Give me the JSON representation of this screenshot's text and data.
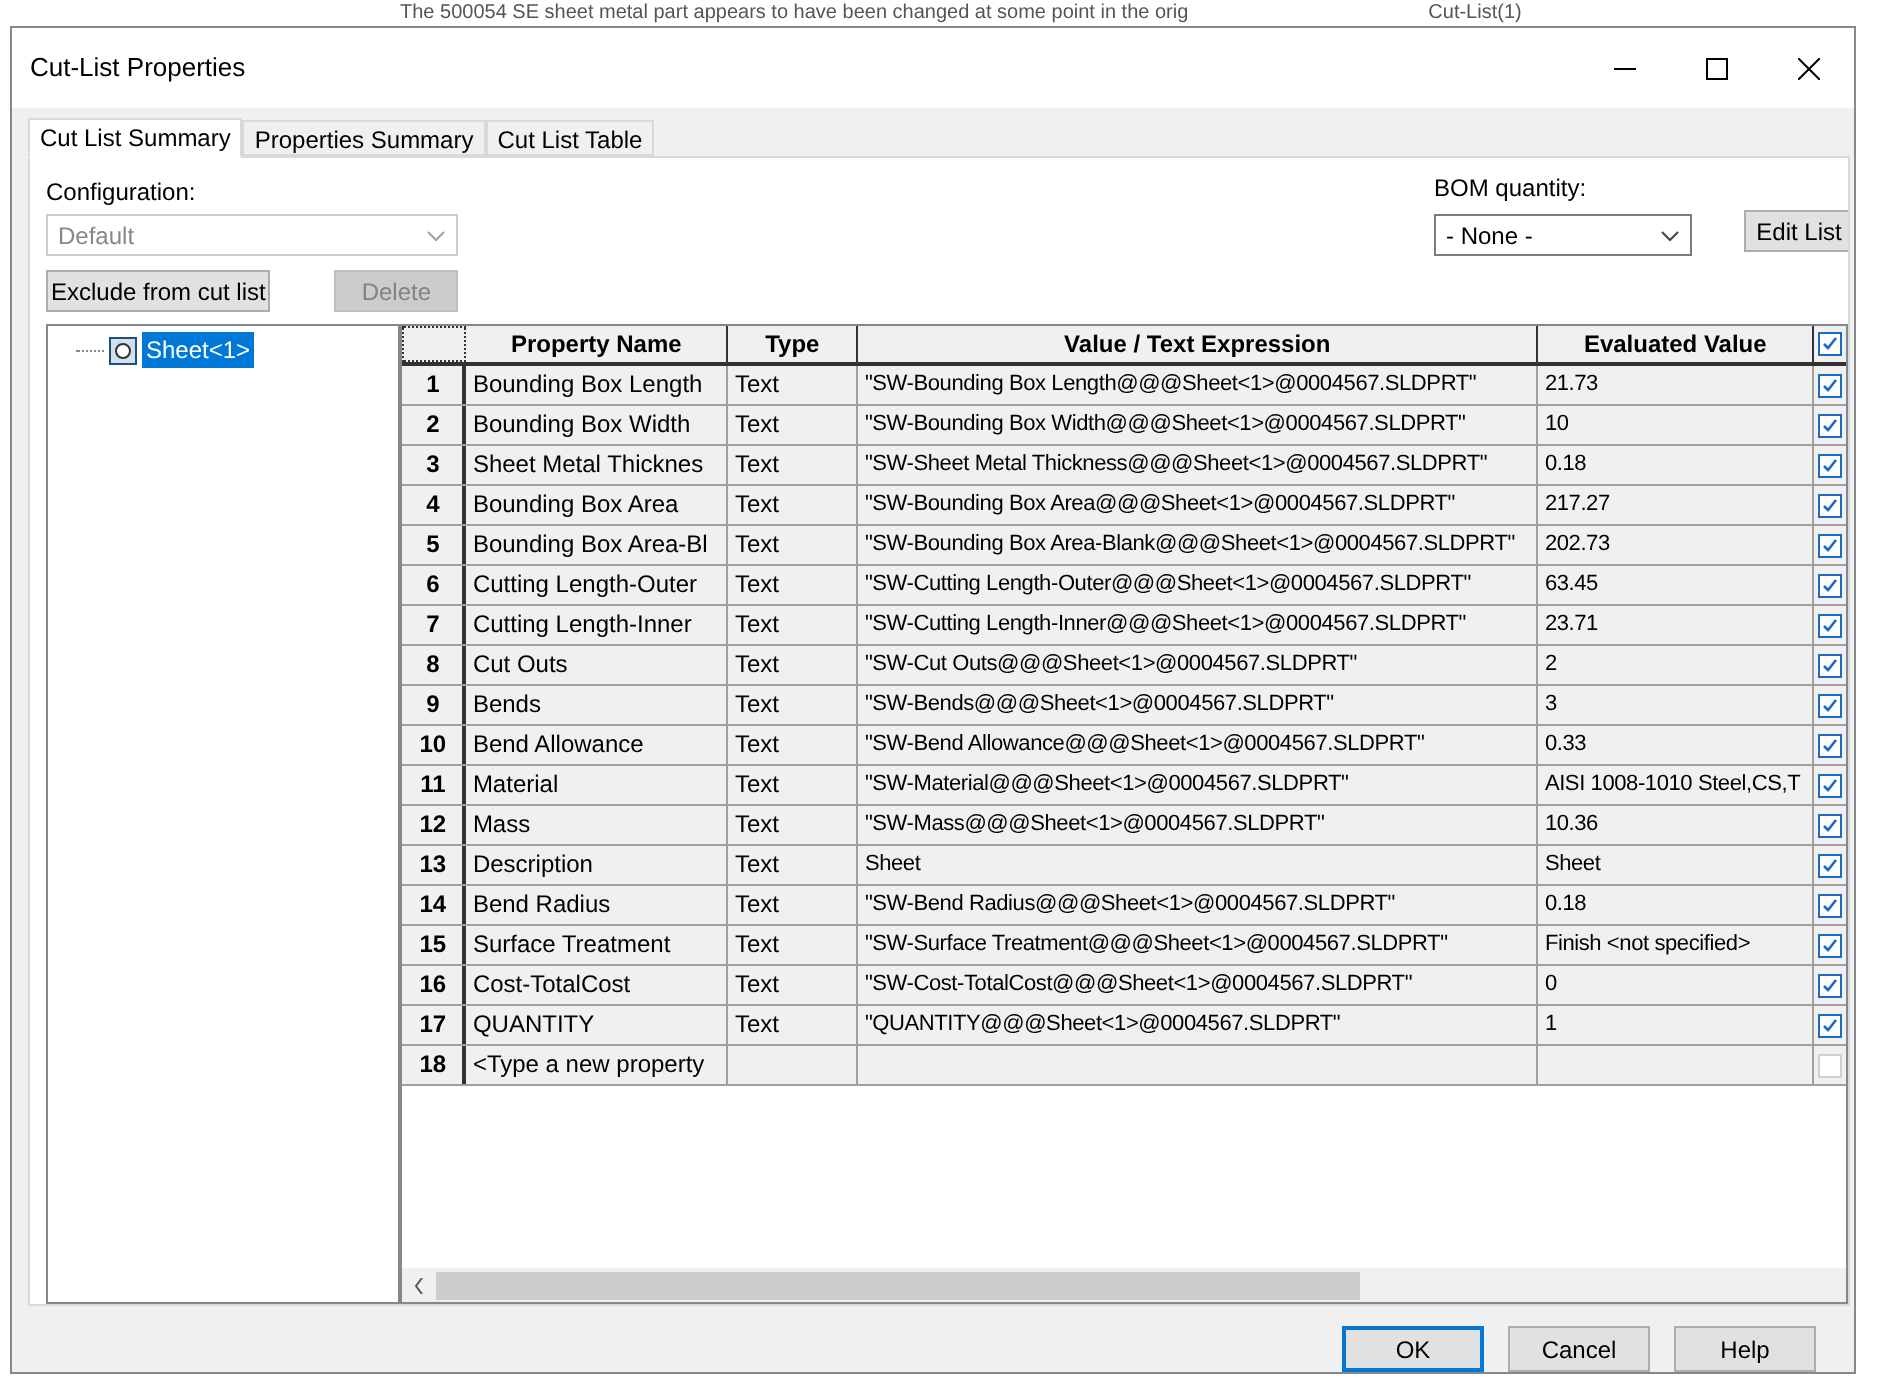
{
  "background": {
    "text": "The 500054 SE sheet metal part appears to have been changed at some point in the orig",
    "item": "Cut-List(1)"
  },
  "window": {
    "title": "Cut-List Properties"
  },
  "tabs": [
    {
      "label": "Cut List Summary",
      "selected": true
    },
    {
      "label": "Properties Summary",
      "selected": false
    },
    {
      "label": "Cut List Table",
      "selected": false
    }
  ],
  "configuration": {
    "label": "Configuration:",
    "value": "Default",
    "disabled": true
  },
  "bom_quantity": {
    "label": "BOM quantity:",
    "value": "- None -"
  },
  "buttons_top": [
    {
      "label": "Exclude from cut list",
      "disabled": false
    },
    {
      "label": "Delete",
      "disabled": true
    },
    {
      "label": "Edit List",
      "disabled": false
    }
  ],
  "tree": {
    "items": [
      {
        "label": "Sheet<1>",
        "selected": true
      }
    ]
  },
  "table": {
    "columns": [
      "Property Name",
      "Type",
      "Value / Text Expression",
      "Evaluated Value"
    ],
    "all_checked": true,
    "rows": [
      {
        "num": "1",
        "name": "Bounding Box Length",
        "type": "Text",
        "expression": "\"SW-Bounding Box Length@@@Sheet<1>@0004567.SLDPRT\"",
        "value": "21.73",
        "checked": true
      },
      {
        "num": "2",
        "name": "Bounding Box Width",
        "type": "Text",
        "expression": "\"SW-Bounding Box Width@@@Sheet<1>@0004567.SLDPRT\"",
        "value": "10",
        "checked": true
      },
      {
        "num": "3",
        "name": "Sheet Metal Thicknes",
        "type": "Text",
        "expression": "\"SW-Sheet Metal Thickness@@@Sheet<1>@0004567.SLDPRT\"",
        "value": "0.18",
        "checked": true
      },
      {
        "num": "4",
        "name": "Bounding Box Area",
        "type": "Text",
        "expression": "\"SW-Bounding Box Area@@@Sheet<1>@0004567.SLDPRT\"",
        "value": "217.27",
        "checked": true
      },
      {
        "num": "5",
        "name": "Bounding Box Area-Bl",
        "type": "Text",
        "expression": "\"SW-Bounding Box Area-Blank@@@Sheet<1>@0004567.SLDPRT\"",
        "value": "202.73",
        "checked": true
      },
      {
        "num": "6",
        "name": "Cutting Length-Outer",
        "type": "Text",
        "expression": "\"SW-Cutting Length-Outer@@@Sheet<1>@0004567.SLDPRT\"",
        "value": "63.45",
        "checked": true
      },
      {
        "num": "7",
        "name": "Cutting Length-Inner",
        "type": "Text",
        "expression": "\"SW-Cutting Length-Inner@@@Sheet<1>@0004567.SLDPRT\"",
        "value": "23.71",
        "checked": true
      },
      {
        "num": "8",
        "name": "Cut Outs",
        "type": "Text",
        "expression": "\"SW-Cut Outs@@@Sheet<1>@0004567.SLDPRT\"",
        "value": "2",
        "checked": true
      },
      {
        "num": "9",
        "name": "Bends",
        "type": "Text",
        "expression": "\"SW-Bends@@@Sheet<1>@0004567.SLDPRT\"",
        "value": "3",
        "checked": true
      },
      {
        "num": "10",
        "name": "Bend Allowance",
        "type": "Text",
        "expression": "\"SW-Bend Allowance@@@Sheet<1>@0004567.SLDPRT\"",
        "value": "0.33",
        "checked": true
      },
      {
        "num": "11",
        "name": "Material",
        "type": "Text",
        "expression": "\"SW-Material@@@Sheet<1>@0004567.SLDPRT\"",
        "value": "AISI 1008-1010 Steel,CS,T",
        "checked": true
      },
      {
        "num": "12",
        "name": "Mass",
        "type": "Text",
        "expression": "\"SW-Mass@@@Sheet<1>@0004567.SLDPRT\"",
        "value": "10.36",
        "checked": true
      },
      {
        "num": "13",
        "name": "Description",
        "type": "Text",
        "expression": "Sheet",
        "value": "Sheet",
        "checked": true
      },
      {
        "num": "14",
        "name": "Bend Radius",
        "type": "Text",
        "expression": "\"SW-Bend Radius@@@Sheet<1>@0004567.SLDPRT\"",
        "value": "0.18",
        "checked": true
      },
      {
        "num": "15",
        "name": "Surface Treatment",
        "type": "Text",
        "expression": "\"SW-Surface Treatment@@@Sheet<1>@0004567.SLDPRT\"",
        "value": "Finish <not specified>",
        "checked": true
      },
      {
        "num": "16",
        "name": "Cost-TotalCost",
        "type": "Text",
        "expression": "\"SW-Cost-TotalCost@@@Sheet<1>@0004567.SLDPRT\"",
        "value": "0",
        "checked": true
      },
      {
        "num": "17",
        "name": "QUANTITY",
        "type": "Text",
        "expression": "\"QUANTITY@@@Sheet<1>@0004567.SLDPRT\"",
        "value": "1",
        "checked": true
      },
      {
        "num": "18",
        "name": "<Type a new property",
        "type": "",
        "expression": "",
        "value": "",
        "checked": false
      }
    ]
  },
  "buttons_bottom": [
    {
      "label": "OK",
      "default": true
    },
    {
      "label": "Cancel",
      "default": false
    },
    {
      "label": "Help",
      "default": false
    }
  ]
}
